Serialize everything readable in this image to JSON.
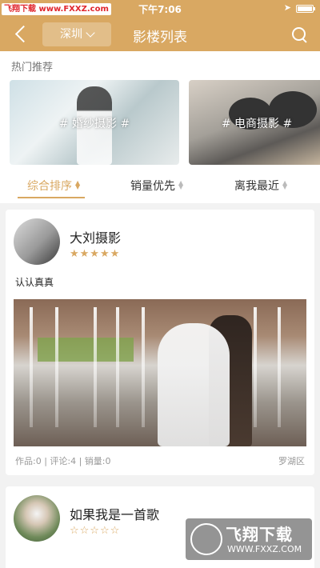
{
  "status_bar": {
    "watermark": "飞翔下载 www.FXXZ.com",
    "time": "下午7:06",
    "location_icon": "location-arrow-icon",
    "battery_icon": "battery-icon"
  },
  "nav": {
    "back_icon": "back-chevron-icon",
    "city": "深圳",
    "title": "影楼列表",
    "search_icon": "search-icon"
  },
  "hot": {
    "title": "热门推荐",
    "banners": [
      {
        "tag": "# 婚纱摄影 #"
      },
      {
        "tag": "# 电商摄影 #"
      }
    ]
  },
  "sort": {
    "items": [
      {
        "label": "综合排序"
      },
      {
        "label": "销量优先"
      },
      {
        "label": "离我最近"
      }
    ],
    "active_color": "#d9a862"
  },
  "cards": [
    {
      "name": "大刘摄影",
      "rating": 5,
      "stars": "★★★★★",
      "desc": "认认真真",
      "meta": "作品:0 | 评论:4 | 销量:0",
      "district": "罗湖区"
    },
    {
      "name": "如果我是一首歌",
      "rating": 0,
      "stars": "☆☆☆☆☆"
    }
  ],
  "watermark": {
    "main": "飞翔下载",
    "sub": "WWW.FXXZ.COM"
  },
  "colors": {
    "accent": "#d9a862"
  }
}
